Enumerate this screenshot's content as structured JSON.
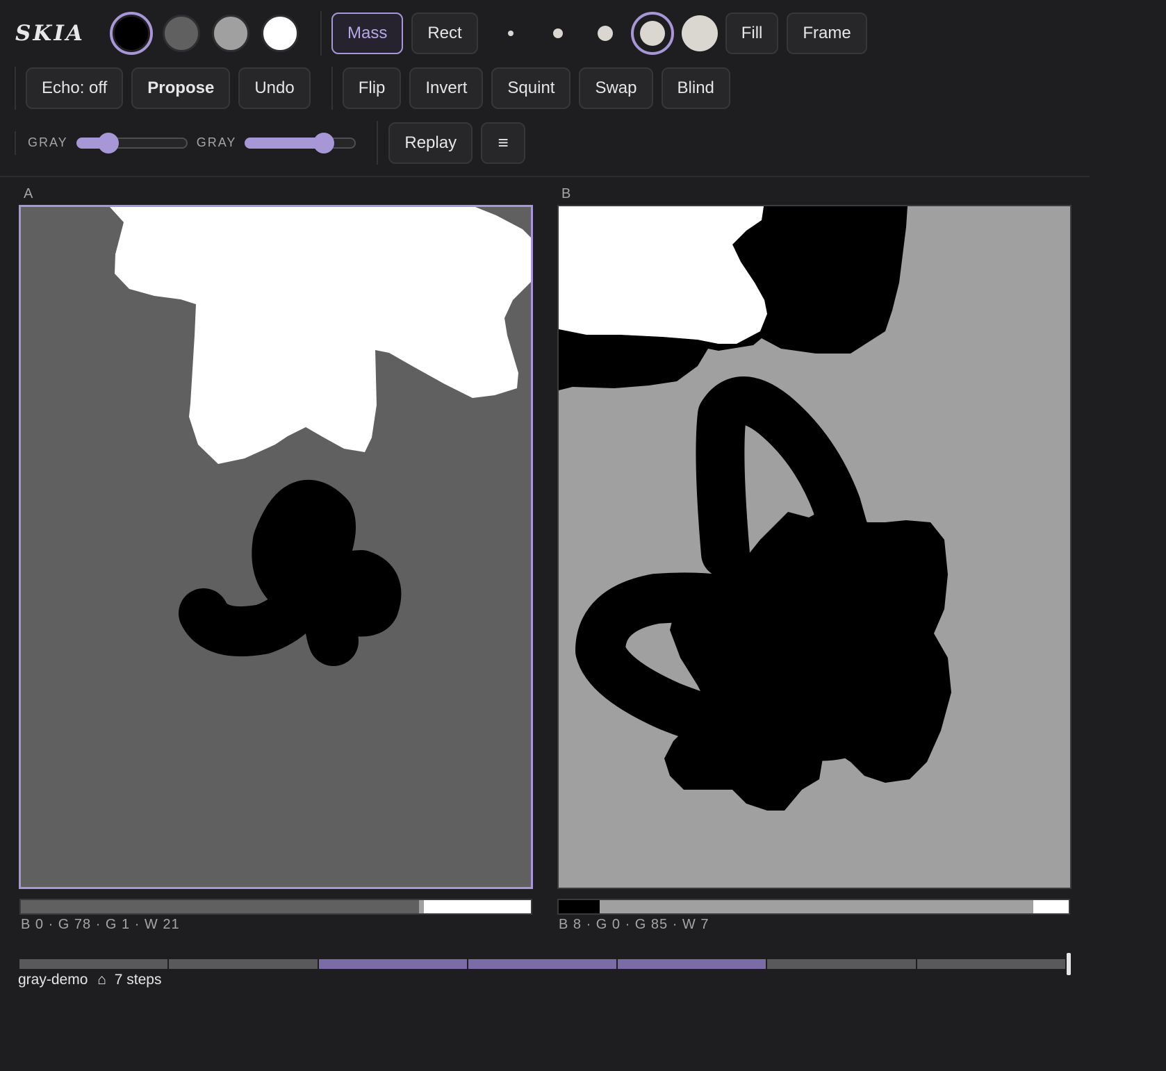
{
  "app": {
    "logo": "SKIA"
  },
  "toolbar": {
    "swatches": [
      {
        "name": "black",
        "color": "#000000",
        "selected": true
      },
      {
        "name": "dark-gray",
        "color": "#606060",
        "selected": false
      },
      {
        "name": "light-gray",
        "color": "#a0a0a0",
        "selected": false
      },
      {
        "name": "white",
        "color": "#ffffff",
        "selected": false
      }
    ],
    "mass_label": "Mass",
    "rect_label": "Rect",
    "brush_sizes": [
      {
        "name": "brush-size-1",
        "level": 1
      },
      {
        "name": "brush-size-2",
        "level": 2
      },
      {
        "name": "brush-size-3",
        "level": 3
      },
      {
        "name": "brush-size-4",
        "level": 4,
        "selected": true
      },
      {
        "name": "brush-size-5",
        "level": 5
      }
    ],
    "fill_label": "Fill",
    "frame_label": "Frame",
    "echo_label": "Echo: off",
    "propose_label": "Propose",
    "undo_label": "Undo",
    "flip_label": "Flip",
    "invert_label": "Invert",
    "squint_label": "Squint",
    "swap_label": "Swap",
    "blind_label": "Blind",
    "slider1": {
      "label": "GRAY",
      "value": 0.29
    },
    "slider2": {
      "label": "GRAY",
      "value": 0.71
    },
    "replay_label": "Replay",
    "menu_glyph": "≡"
  },
  "panels": [
    {
      "label": "A",
      "stats": "B 0 · G 78 · G 1 · W 21",
      "distribution": {
        "black": 0,
        "dark_gray": 78,
        "light_gray": 1,
        "white": 21
      }
    },
    {
      "label": "B",
      "stats": "B 8 · G 0 · G 85 · W 7",
      "distribution": {
        "black": 8,
        "dark_gray": 0,
        "light_gray": 85,
        "white": 7
      }
    }
  ],
  "colors": {
    "accent": "#a897d6",
    "black": "#000000",
    "dark_gray": "#606060",
    "light_gray": "#a0a0a0",
    "white": "#ffffff"
  },
  "timeline": {
    "segments": 7,
    "highlighted": [
      2,
      3,
      4
    ]
  },
  "footer": {
    "project": "gray-demo",
    "icon": "home-icon",
    "home_glyph": "⌂",
    "steps": "7 steps"
  }
}
